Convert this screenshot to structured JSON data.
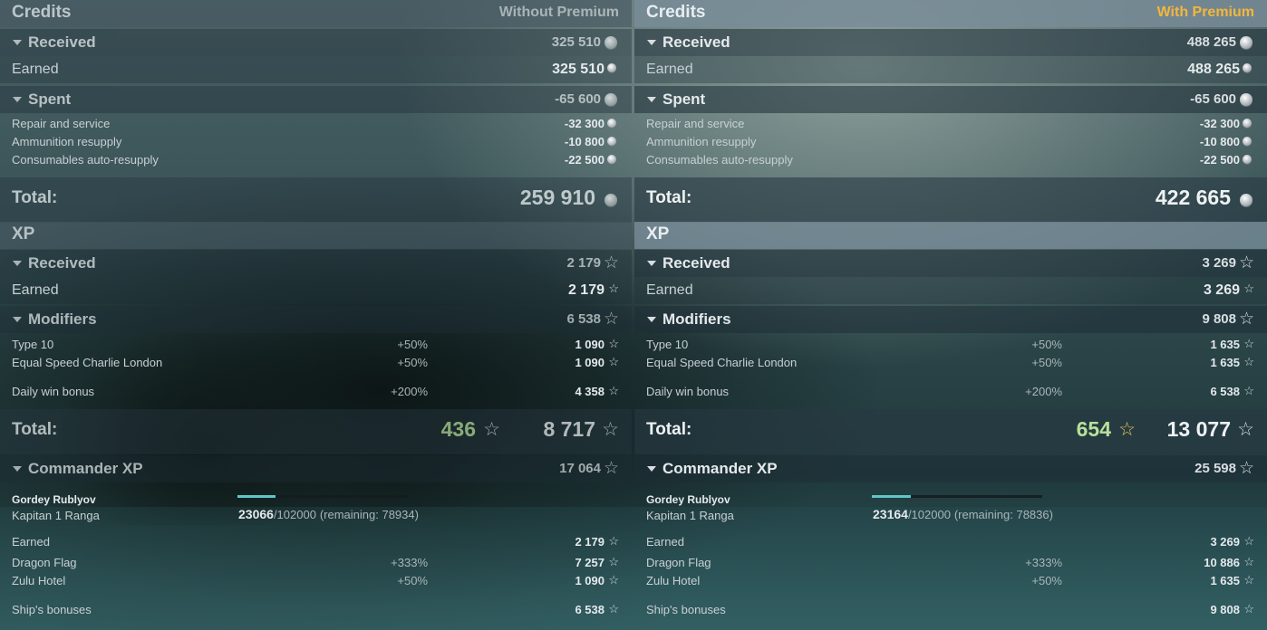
{
  "left": {
    "credits_title": "Credits",
    "variant": "Without Premium",
    "received_label": "Received",
    "received_total": "325 510",
    "earned_label": "Earned",
    "earned_value": "325 510",
    "spent_label": "Spent",
    "spent_total": "-65 600",
    "repair_label": "Repair and service",
    "repair_value": "-32 300",
    "ammo_label": "Ammunition resupply",
    "ammo_value": "-10 800",
    "cons_label": "Consumables auto-resupply",
    "cons_value": "-22 500",
    "total_label": "Total:",
    "credits_total": "259 910",
    "xp_title": "XP",
    "xp_received": "2 179",
    "xp_earned": "2 179",
    "modifiers_label": "Modifiers",
    "modifiers_total": "6 538",
    "mod1_label": "Type 10",
    "mod1_pct": "+50%",
    "mod1_value": "1 090",
    "mod2_label": "Equal Speed Charlie London",
    "mod2_pct": "+50%",
    "mod2_value": "1 090",
    "mod3_label": "Daily win bonus",
    "mod3_pct": "+200%",
    "mod3_value": "4 358",
    "xp_total_small": "436",
    "xp_total": "8 717",
    "cmdr_label": "Commander XP",
    "cmdr_total": "17 064",
    "cmdr_name": "Gordey Rublyov",
    "cmdr_rank": "Kapitan 1 Ranga",
    "cmdr_xp": "23066",
    "cmdr_max": "/102000",
    "cmdr_remaining": "(remaining: 78934)",
    "cmdr_progress": 0.226,
    "c_earned": "2 179",
    "c1_label": "Dragon Flag",
    "c1_pct": "+333%",
    "c1_value": "7 257",
    "c2_label": "Zulu Hotel",
    "c2_pct": "+50%",
    "c2_value": "1 090",
    "ship_label": "Ship's bonuses",
    "ship_value": "6 538"
  },
  "right": {
    "credits_title": "Credits",
    "variant": "With Premium",
    "received_label": "Received",
    "received_total": "488 265",
    "earned_label": "Earned",
    "earned_value": "488 265",
    "spent_label": "Spent",
    "spent_total": "-65 600",
    "repair_label": "Repair and service",
    "repair_value": "-32 300",
    "ammo_label": "Ammunition resupply",
    "ammo_value": "-10 800",
    "cons_label": "Consumables auto-resupply",
    "cons_value": "-22 500",
    "total_label": "Total:",
    "credits_total": "422 665",
    "xp_title": "XP",
    "xp_received": "3 269",
    "xp_earned": "3 269",
    "modifiers_label": "Modifiers",
    "modifiers_total": "9 808",
    "mod1_label": "Type 10",
    "mod1_pct": "+50%",
    "mod1_value": "1 635",
    "mod2_label": "Equal Speed Charlie London",
    "mod2_pct": "+50%",
    "mod2_value": "1 635",
    "mod3_label": "Daily win bonus",
    "mod3_pct": "+200%",
    "mod3_value": "6 538",
    "xp_total_small": "654",
    "xp_total": "13 077",
    "cmdr_label": "Commander XP",
    "cmdr_total": "25 598",
    "cmdr_name": "Gordey Rublyov",
    "cmdr_rank": "Kapitan 1 Ranga",
    "cmdr_xp": "23164",
    "cmdr_max": "/102000",
    "cmdr_remaining": "(remaining: 78836)",
    "cmdr_progress": 0.227,
    "c_earned": "3 269",
    "c1_label": "Dragon Flag",
    "c1_pct": "+333%",
    "c1_value": "10 886",
    "c2_label": "Zulu Hotel",
    "c2_pct": "+50%",
    "c2_value": "1 635",
    "ship_label": "Ship's bonuses",
    "ship_value": "9 808"
  },
  "colors": {
    "premium": "#f3b73a",
    "xp_green": "#b7e19a",
    "progress": "#5ec6c9"
  },
  "icons": {
    "credits": "credits-coin-icon",
    "xp": "xp-star-icon",
    "expand": "chevron-down-icon"
  }
}
